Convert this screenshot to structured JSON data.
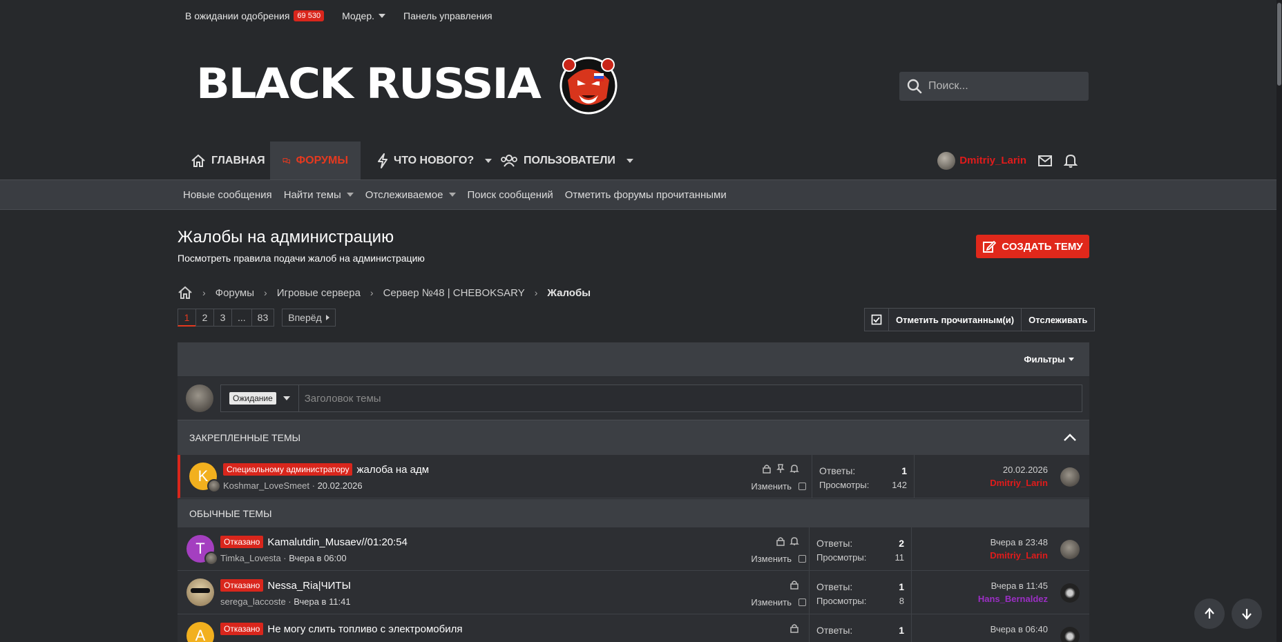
{
  "topbar": {
    "pending_label": "В ожидании одобрения",
    "pending_count": "69 530",
    "moder_label": "Модер.",
    "panel_label": "Панель управления"
  },
  "header": {
    "logo_text": "BLACK RUSSIA",
    "search_placeholder": "Поиск..."
  },
  "nav": {
    "items": [
      {
        "label": "ГЛАВНАЯ",
        "icon": "home-icon"
      },
      {
        "label": "ФОРУМЫ",
        "icon": "forums-icon",
        "active": true
      },
      {
        "label": "ЧТО НОВОГО?",
        "icon": "lightning-icon"
      },
      {
        "label": "ПОЛЬЗОВАТЕЛИ",
        "icon": "users-icon"
      }
    ],
    "username": "Dmitriy_Larin"
  },
  "subnav": {
    "items": [
      "Новые сообщения",
      "Найти темы",
      "Отслеживаемое",
      "Поиск сообщений",
      "Отметить форумы прочитанными"
    ]
  },
  "page": {
    "title": "Жалобы на администрацию",
    "description": "Посмотреть правила подачи жалоб на администрацию",
    "create_button": "СОЗДАТЬ ТЕМУ"
  },
  "breadcrumb": [
    "Форумы",
    "Игровые сервера",
    "Сервер №48 | CHEBOKSARY",
    "Жалобы"
  ],
  "pager": {
    "pages": [
      "1",
      "2",
      "3",
      "...",
      "83"
    ],
    "current": "1",
    "next_label": "Вперёд"
  },
  "actions": {
    "mark_read": "Отметить прочитанным(и)",
    "watch": "Отслеживать"
  },
  "filters_label": "Фильтры",
  "quick_thread": {
    "prefix": "Ожидание",
    "placeholder": "Заголовок темы"
  },
  "sections": {
    "pinned": "ЗАКРЕПЛЕННЫЕ ТЕМЫ",
    "normal": "ОБЫЧНЫЕ ТЕМЫ"
  },
  "labels": {
    "replies": "Ответы:",
    "views": "Просмотры:",
    "edit": "Изменить"
  },
  "pinned_threads": [
    {
      "avatar_letter": "K",
      "avatar_color": "#f2b01e",
      "prefix": "Специальному администратору",
      "title": "жалоба на адм",
      "author": "Koshmar_LoveSmeet",
      "date": "20.02.2026",
      "replies": "1",
      "views": "142",
      "last_date": "20.02.2026",
      "last_user": "Dmitriy_Larin"
    }
  ],
  "threads": [
    {
      "avatar_letter": "T",
      "avatar_color": "#a43fc0",
      "prefix": "Отказано",
      "title": "Kamalutdin_Musaev//01:20:54",
      "author": "Timka_Lovesta",
      "date": "Вчера в 06:00",
      "replies": "2",
      "views": "11",
      "last_date": "Вчера в 23:48",
      "last_user": "Dmitriy_Larin"
    },
    {
      "avatar_letter": "",
      "avatar_color": "#c9b38a",
      "prefix": "Отказано",
      "title": "Nessa_Ria|ЧИТЫ",
      "author": "serega_laccoste",
      "date": "Вчера в 11:41",
      "replies": "1",
      "views": "8",
      "last_date": "Вчера в 11:45",
      "last_user": "Hans_Bernaldez"
    },
    {
      "avatar_letter": "A",
      "avatar_color": "#f2b01e",
      "prefix": "Отказано",
      "title": "Не могу слить топливо с электромобиля",
      "replies": "1",
      "last_date": "Вчера в 06:40"
    }
  ],
  "colors": {
    "accent": "#e0281b",
    "background": "#27292c",
    "panel": "#3c3f44",
    "username_red": "#e11b1b"
  }
}
